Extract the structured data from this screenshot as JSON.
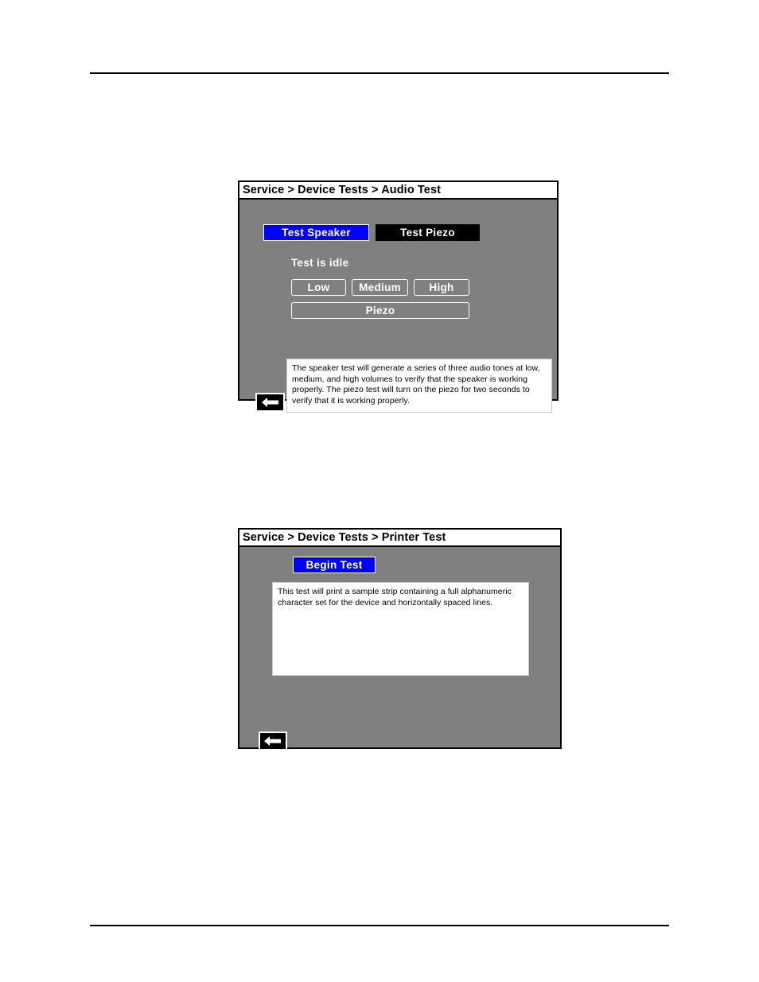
{
  "page": {
    "header_rule": "",
    "footer_rule": ""
  },
  "audio_panel": {
    "breadcrumb": "Service > Device Tests > Audio Test",
    "test_speaker_label": "Test Speaker",
    "test_piezo_label": "Test Piezo",
    "status_text": "Test is idle",
    "volume_buttons": [
      {
        "label": "Low"
      },
      {
        "label": "Medium"
      },
      {
        "label": "High"
      }
    ],
    "piezo_label": "Piezo",
    "description": "The speaker test will generate a series of three audio tones at low, medium, and high volumes to verify that the speaker is working properly.  The piezo test will turn on the piezo for two seconds to verify that it is working properly.",
    "back_icon": "left-arrow-icon",
    "colors": {
      "selected_button": "#0000ff",
      "unselected_button": "#000000",
      "panel_background": "#808080",
      "titlebar_background": "#ffffff",
      "text_on_button": "#ffffff"
    }
  },
  "printer_panel": {
    "breadcrumb": "Service > Device Tests > Printer Test",
    "begin_test_label": "Begin Test",
    "description": "This test will print a sample strip containing a full alphanumeric character set for the device and horizontally spaced lines.",
    "back_icon": "left-arrow-icon",
    "colors": {
      "begin_button": "#0000ff",
      "panel_background": "#808080",
      "info_background": "#ffffff"
    }
  }
}
